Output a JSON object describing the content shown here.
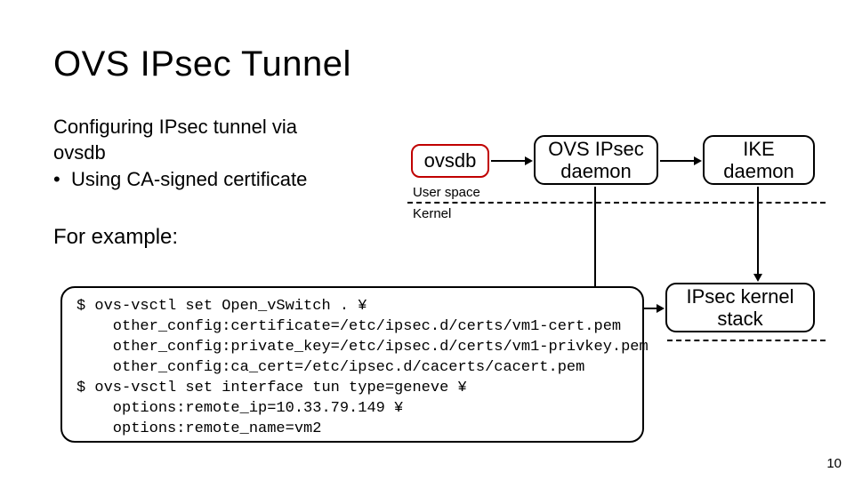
{
  "title": "OVS IPsec Tunnel",
  "intro": {
    "line1": "Configuring IPsec tunnel via",
    "line2": "ovsdb",
    "bullet": "Using CA-signed certificate"
  },
  "for_example": "For example:",
  "diagram": {
    "ovsdb": "ovsdb",
    "ipsec_daemon": "OVS IPsec\ndaemon",
    "ike_daemon": "IKE\ndaemon",
    "kernel_stack": "IPsec kernel\nstack",
    "user_space_label": "User space",
    "kernel_label": "Kernel"
  },
  "code": "$ ovs-vsctl set Open_vSwitch . ¥\n    other_config:certificate=/etc/ipsec.d/certs/vm1-cert.pem\n    other_config:private_key=/etc/ipsec.d/certs/vm1-privkey.pem\n    other_config:ca_cert=/etc/ipsec.d/cacerts/cacert.pem\n$ ovs-vsctl set interface tun type=geneve ¥\n    options:remote_ip=10.33.79.149 ¥\n    options:remote_name=vm2",
  "page_number": "10"
}
